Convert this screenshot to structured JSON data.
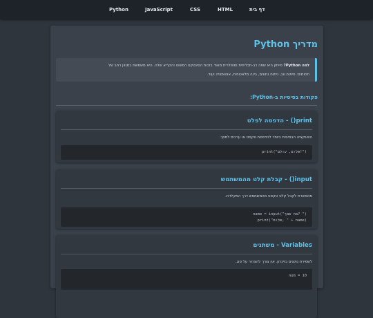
{
  "nav": {
    "items": [
      {
        "id": "nav-python",
        "label": "Python"
      },
      {
        "id": "nav-js",
        "label": "JavaScript"
      },
      {
        "id": "nav-css",
        "label": "CSS"
      },
      {
        "id": "nav-html",
        "label": "HTML"
      },
      {
        "id": "nav-home",
        "label": "דף בית"
      }
    ]
  },
  "page": {
    "title": "מדריך Python",
    "intro_lead": "למה Python?",
    "intro_line1": " פייתון היא שפה רב-תכליתית ומפולרית מאוד בזכות הסינטקס הפשוט והקריא שלה. היא משמשת במגוון רחב של",
    "intro_line2": "תחומים: פיתוח ווב, ניתוח נתונים, בינה מלאכותית, אוטומציה ועוד.",
    "section_title": "פקודות בסיסיות ב-Python:"
  },
  "cards": {
    "print": {
      "title": "print() - הדפסה לפלט",
      "desc": "הפונקציה הבסיסית ביותר להדפסת טקסט או ערכים למסך.",
      "code": [
        "print(\"שלום, עולם!\")"
      ]
    },
    "input": {
      "title": "input() - קבלת קלט מהמשתמש",
      "desc": "מאפשרת לקבל קלט טקסט מהמשתמש דרך המקלדת.",
      "code": [
        "name = input(\"מה שמך? \")",
        "print(\"שלום, \" + name)"
      ]
    },
    "vars": {
      "title": "Variables - משתנים",
      "desc": "לשמירת נתונים בזיכרון. אין צורך להצהיר על סוג.",
      "code": [
        "num = 10"
      ]
    }
  },
  "colors": {
    "accent": "#5ec1e8",
    "background": "#2f353d",
    "nav_bg": "#1e2329",
    "code_bg": "#23272c"
  }
}
